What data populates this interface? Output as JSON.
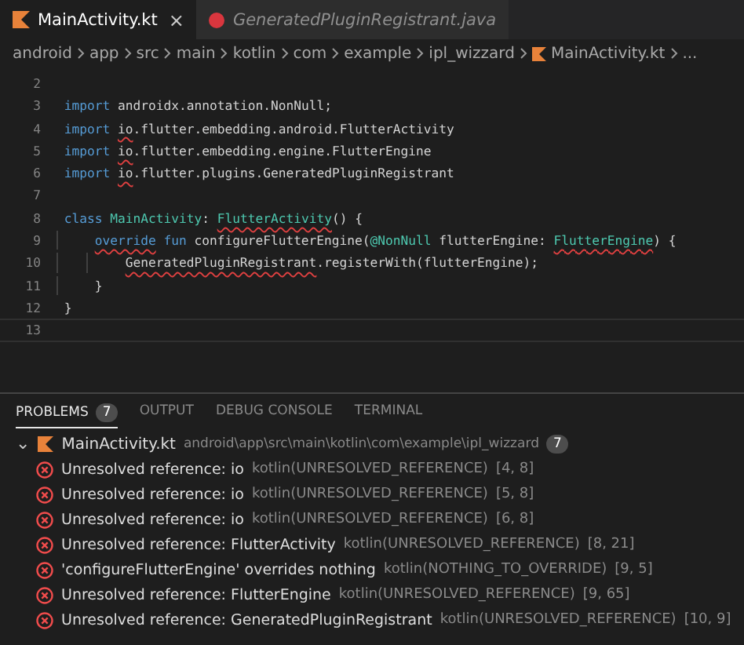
{
  "tabs": [
    {
      "label": "MainActivity.kt",
      "selected": true,
      "preview": false,
      "kind": "kotlin",
      "close": "×"
    },
    {
      "label": "GeneratedPluginRegistrant.java",
      "selected": false,
      "preview": true,
      "kind": "error"
    }
  ],
  "breadcrumbs": [
    {
      "text": "android",
      "kind": "folder"
    },
    {
      "text": "app",
      "kind": "folder"
    },
    {
      "text": "src",
      "kind": "folder"
    },
    {
      "text": "main",
      "kind": "folder"
    },
    {
      "text": "kotlin",
      "kind": "folder"
    },
    {
      "text": "com",
      "kind": "folder"
    },
    {
      "text": "example",
      "kind": "folder"
    },
    {
      "text": "ipl_wizzard",
      "kind": "folder"
    },
    {
      "text": "MainActivity.kt",
      "kind": "kotlin"
    },
    {
      "text": "...",
      "kind": "folder"
    }
  ],
  "code_lines": [
    {
      "number": "2",
      "current": false
    },
    {
      "number": "3",
      "current": false,
      "tokens": [
        {
          "text": "import",
          "kind": "keyword"
        },
        {
          "text": " androidx.annotation.NonNull;",
          "kind": "plain"
        }
      ]
    },
    {
      "number": "4",
      "current": false,
      "tokens": [
        {
          "text": "import ",
          "kind": "keyword"
        },
        {
          "text": "io",
          "kind": "plain",
          "squiggle": true
        },
        {
          "text": ".flutter.embedding.android.FlutterActivity",
          "kind": "plain"
        }
      ]
    },
    {
      "number": "5",
      "current": false,
      "tokens": [
        {
          "text": "import ",
          "kind": "keyword"
        },
        {
          "text": "io",
          "kind": "plain",
          "squiggle": true
        },
        {
          "text": ".flutter.embedding.engine.FlutterEngine",
          "kind": "plain"
        }
      ]
    },
    {
      "number": "6",
      "current": false,
      "tokens": [
        {
          "text": "import ",
          "kind": "keyword"
        },
        {
          "text": "io",
          "kind": "plain",
          "squiggle": true
        },
        {
          "text": ".flutter.plugins.GeneratedPluginRegistrant",
          "kind": "plain"
        }
      ]
    },
    {
      "number": "7",
      "current": false
    },
    {
      "number": "8",
      "current": false,
      "tokens": [
        {
          "text": "class ",
          "kind": "keyword"
        },
        {
          "text": "MainActivity",
          "kind": "type"
        },
        {
          "text": ": ",
          "kind": "plain"
        },
        {
          "text": "FlutterActivity",
          "kind": "type",
          "squiggle": true
        },
        {
          "text": "() {",
          "kind": "plain"
        }
      ],
      "children": [
        {
          "number": "9",
          "current": false,
          "tokens": [
            {
              "text": "override",
              "kind": "keyword",
              "squiggle": true
            },
            {
              "text": " fun",
              "kind": "keyword"
            },
            {
              "text": " configureFlutterEngine(",
              "kind": "plain"
            },
            {
              "text": "@NonNull",
              "kind": "annotation"
            },
            {
              "text": " flutterEngine: ",
              "kind": "plain"
            },
            {
              "text": "FlutterEngine",
              "kind": "type",
              "squiggle": true
            },
            {
              "text": ") {",
              "kind": "plain"
            }
          ],
          "children": [
            {
              "number": "10",
              "current": false,
              "tokens": [
                {
                  "text": "GeneratedPluginRegistrant",
                  "kind": "plain",
                  "squiggle": true
                },
                {
                  "text": ".registerWith(flutterEngine);",
                  "kind": "plain"
                }
              ]
            }
          ]
        },
        {
          "number": "11",
          "current": false,
          "tokens": [
            {
              "text": "}",
              "kind": "plain"
            }
          ]
        }
      ]
    },
    {
      "number": "12",
      "current": false,
      "tokens": [
        {
          "text": "}",
          "kind": "plain"
        }
      ]
    },
    {
      "number": "13",
      "current": true
    }
  ],
  "panel_tabs": [
    {
      "label": "PROBLEMS",
      "selected": true,
      "badge": "7"
    },
    {
      "label": "OUTPUT",
      "selected": false
    },
    {
      "label": "DEBUG CONSOLE",
      "selected": false
    },
    {
      "label": "TERMINAL",
      "selected": false
    }
  ],
  "problems": {
    "file": "MainActivity.kt",
    "path": "android\\app\\src\\main\\kotlin\\com\\example\\ipl_wizzard",
    "count": "7",
    "expanded": true,
    "chevron": "⌄",
    "children": [
      {
        "message": "Unresolved reference: io",
        "source": "kotlin(UNRESOLVED_REFERENCE)",
        "location": "[4, 8]"
      },
      {
        "message": "Unresolved reference: io",
        "source": "kotlin(UNRESOLVED_REFERENCE)",
        "location": "[5, 8]"
      },
      {
        "message": "Unresolved reference: io",
        "source": "kotlin(UNRESOLVED_REFERENCE)",
        "location": "[6, 8]"
      },
      {
        "message": "Unresolved reference: FlutterActivity",
        "source": "kotlin(UNRESOLVED_REFERENCE)",
        "location": "[8, 21]"
      },
      {
        "message": "'configureFlutterEngine' overrides nothing",
        "source": "kotlin(NOTHING_TO_OVERRIDE)",
        "location": "[9, 5]"
      },
      {
        "message": "Unresolved reference: FlutterEngine",
        "source": "kotlin(UNRESOLVED_REFERENCE)",
        "location": "[9, 65]"
      },
      {
        "message": "Unresolved reference: GeneratedPluginRegistrant",
        "source": "kotlin(UNRESOLVED_REFERENCE)",
        "location": "[10, 9]"
      }
    ]
  }
}
